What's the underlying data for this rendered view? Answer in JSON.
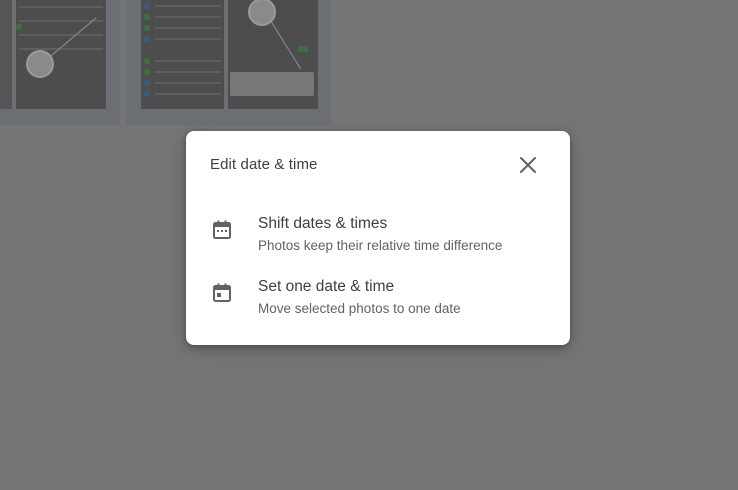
{
  "dialog": {
    "title": "Edit date & time",
    "close_icon": "close-icon",
    "options": [
      {
        "icon": "calendar-icon",
        "label": "Shift dates & times",
        "description": "Photos keep their relative time difference"
      },
      {
        "icon": "calendar-event-icon",
        "label": "Set one date & time",
        "description": "Move selected photos to one date"
      }
    ]
  },
  "colors": {
    "scrim": "#757575",
    "dialog_bg": "#ffffff",
    "primary_text": "#3c4043",
    "secondary_text": "#5f6368",
    "icon": "#5f6368"
  }
}
